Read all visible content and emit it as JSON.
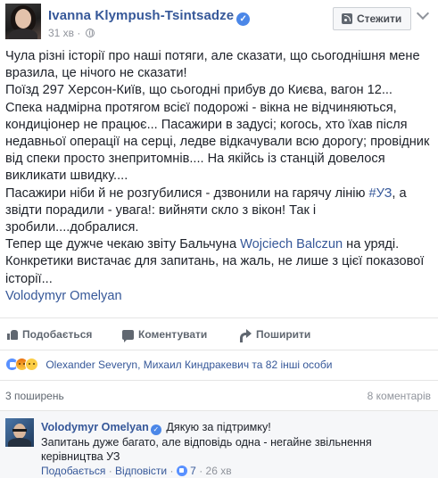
{
  "post": {
    "author": "Ivanna Klympush-Tsintsadze",
    "verified_icon": "verified-badge-icon",
    "time": "31 хв",
    "privacy_icon": "globe-icon",
    "follow_label": "Стежити",
    "options_icon": "chevron-down-icon",
    "paragraphs": [
      "Чула різні історії про наші потяги, але сказати, що сьогоднішня мене вразила, це нічого не сказати!",
      "Поїзд 297 Херсон-Київ, що сьогодні прибув до Києва, вагон 12... Спека надмірна протягом всієї подорожі - вікна не відчиняються, кондиціонер не працює... Пасажири в задусі; когось, хто їхав після недавньої операції на серці, ледве відкачували всю дорогу; провідник від спеки просто знепритомнів.... На якійсь із станцій довелося викликати швидку...."
    ],
    "p3_before": "Пасажири ніби й не розгубилися - дзвонили на гарячу лінію ",
    "p3_hashtag": "#УЗ",
    "p3_after": ", а звідти порадили - увага!: вийняти скло з вікон! Так і зробили....добралися.",
    "p4_before": "Тепер ще дужче чекаю звіту Бальчуна ",
    "p4_link": "Wojciech Balczun",
    "p4_after": " на уряді. Конкретики вистачає для запитань, на жаль, не лише з цієї показової історії...",
    "mention": "Volodymyr Omelyan"
  },
  "actions": {
    "like": "Подобається",
    "comment": "Коментувати",
    "share": "Поширити"
  },
  "reactions": {
    "icons": [
      "like-reaction-icon",
      "angry-reaction-icon",
      "sad-reaction-icon"
    ],
    "names": "Olexander Severyn, Михаил Киндракевич та 82 інші особи"
  },
  "stats": {
    "shares": "3 поширень",
    "comments": "8 коментарів"
  },
  "comment": {
    "author": "Volodymyr Omelyan",
    "text_inline": "Дякую за підтримку!",
    "text_line2": "Запитань дуже багато, але відповідь одна - негайне звільнення керівництва УЗ",
    "like_label": "Подобається",
    "sep": "·",
    "reply_label": "Відповісти",
    "likes": "7",
    "time": "26 хв"
  },
  "colors": {
    "link": "#365899",
    "secondary_text": "#90949c",
    "like_blue": "#5890ff"
  }
}
